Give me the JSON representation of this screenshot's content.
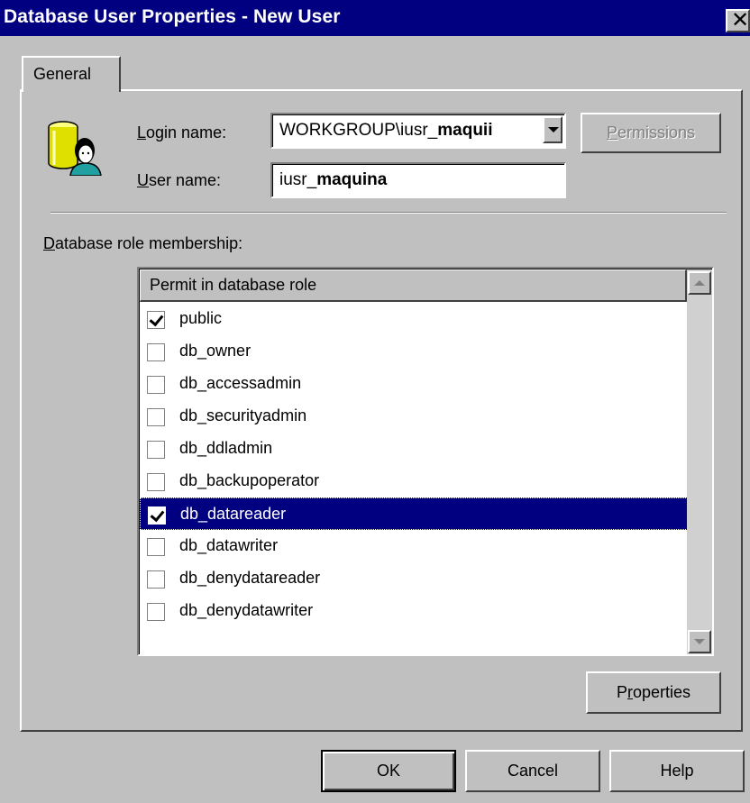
{
  "window": {
    "title": "Database User Properties - New User",
    "close_glyph": "✕"
  },
  "tabs": [
    {
      "label": "General",
      "active": true
    }
  ],
  "form": {
    "login_name_label_accel": "L",
    "login_name_label_rest": "ogin name:",
    "login_name_value_prefix": "WORKGROUP\\iusr_",
    "login_name_value_bold": "maquii",
    "user_name_label_accel": "U",
    "user_name_label_rest": "ser name:",
    "user_name_value_prefix": "iusr_",
    "user_name_value_bold": "maquina",
    "permissions_label_accel": "P",
    "permissions_label_rest": "ermissions"
  },
  "roles_section": {
    "label_accel": "D",
    "label_rest": "atabase role membership:",
    "column_header": "Permit in database role",
    "roles": [
      {
        "name": "public",
        "checked": true,
        "selected": false
      },
      {
        "name": "db_owner",
        "checked": false,
        "selected": false
      },
      {
        "name": "db_accessadmin",
        "checked": false,
        "selected": false
      },
      {
        "name": "db_securityadmin",
        "checked": false,
        "selected": false
      },
      {
        "name": "db_ddladmin",
        "checked": false,
        "selected": false
      },
      {
        "name": "db_backupoperator",
        "checked": false,
        "selected": false
      },
      {
        "name": "db_datareader",
        "checked": true,
        "selected": true
      },
      {
        "name": "db_datawriter",
        "checked": false,
        "selected": false
      },
      {
        "name": "db_denydatareader",
        "checked": false,
        "selected": false
      },
      {
        "name": "db_denydatawriter",
        "checked": false,
        "selected": false
      }
    ],
    "properties_label_accel": "r",
    "properties_label_pre": "P",
    "properties_label_rest": "operties"
  },
  "footer": {
    "ok_label": "OK",
    "cancel_label": "Cancel",
    "help_label": "Help"
  }
}
